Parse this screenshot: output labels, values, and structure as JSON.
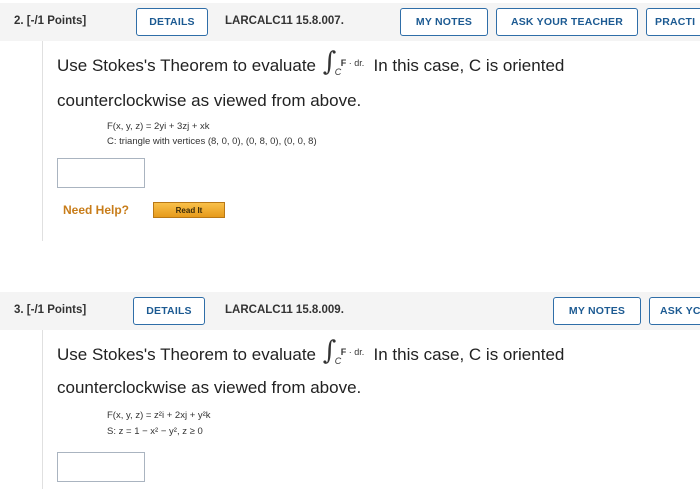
{
  "questions": [
    {
      "number": "2.",
      "points": "[-/1 Points]",
      "details_label": "DETAILS",
      "code": "LARCALC11 15.8.007.",
      "my_notes_label": "MY NOTES",
      "ask_teacher_label": "ASK YOUR TEACHER",
      "practice_label": "PRACTI",
      "line1_pre": "Use Stokes's Theorem to evaluate",
      "integral_symbol": "∫",
      "integral_sub": "C",
      "integral_F": "F",
      "integral_rest": " · dr.",
      "line1_post": "In this case, C is oriented",
      "line2": "counterclockwise as viewed from above.",
      "field": "F(x, y, z) = 2yi + 3zj + xk",
      "region": "C: triangle with vertices (8, 0, 0), (0, 8, 0), (0, 0, 8)",
      "need_help": "Need Help?",
      "read_it": "Read It"
    },
    {
      "number": "3.",
      "points": "[-/1 Points]",
      "details_label": "DETAILS",
      "code": "LARCALC11 15.8.009.",
      "my_notes_label": "MY NOTES",
      "ask_teacher_label": "ASK YC",
      "line1_pre": "Use Stokes's Theorem to evaluate",
      "integral_symbol": "∫",
      "integral_sub": "C",
      "integral_F": "F",
      "integral_rest": " · dr.",
      "line1_post": "In this case, C is oriented",
      "line2": "counterclockwise as viewed from above.",
      "field": "F(x, y, z) = z²i + 2xj + y²k",
      "region": "S: z = 1 − x² − y²,  z ≥ 0"
    }
  ]
}
